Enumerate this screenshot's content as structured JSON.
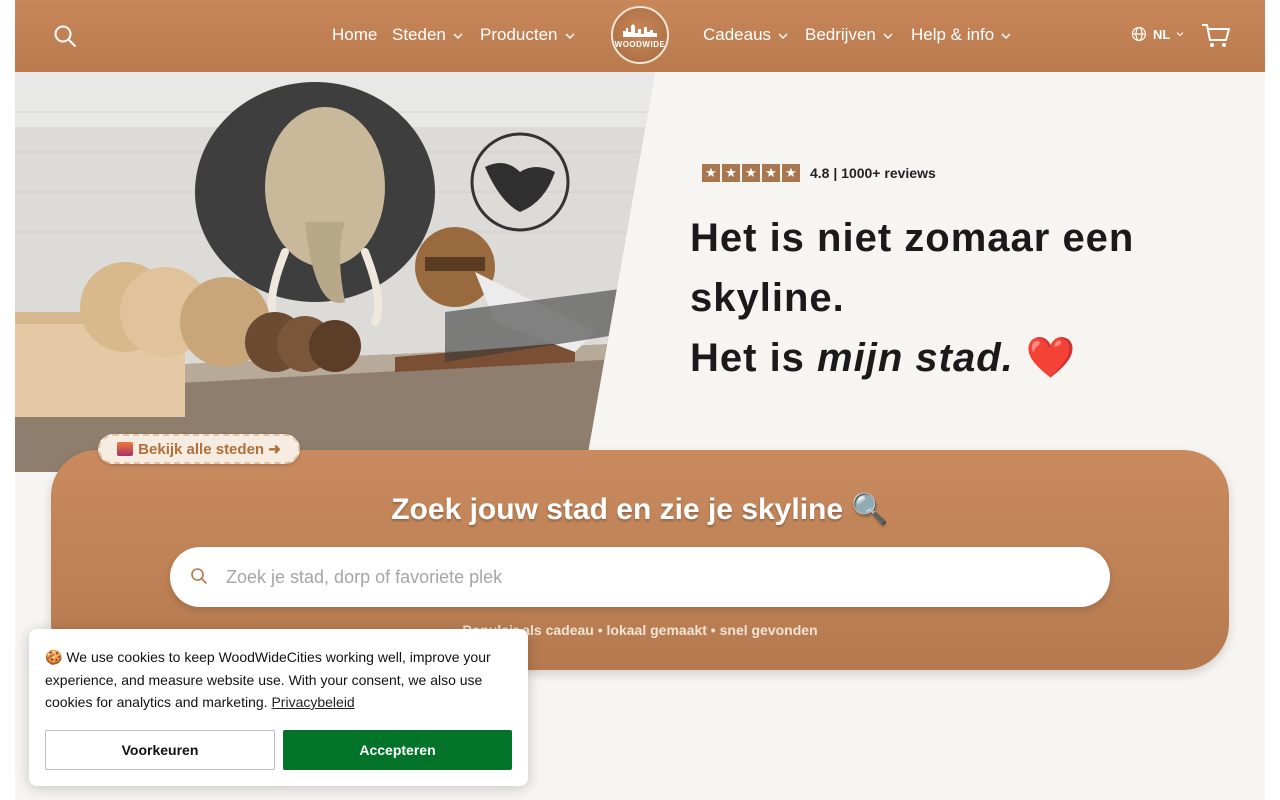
{
  "header": {
    "nav_left": [
      {
        "label": "Home",
        "has_dropdown": false
      },
      {
        "label": "Steden",
        "has_dropdown": true
      },
      {
        "label": "Producten",
        "has_dropdown": true
      }
    ],
    "nav_right": [
      {
        "label": "Cadeaus",
        "has_dropdown": true
      },
      {
        "label": "Bedrijven",
        "has_dropdown": true
      },
      {
        "label": "Help & info",
        "has_dropdown": true
      }
    ],
    "logo_text": "WOODWIDE",
    "language": "NL",
    "icons": [
      "search-icon",
      "globe-icon",
      "cart-icon"
    ],
    "background": "#c08256"
  },
  "hero": {
    "rating": {
      "stars": 5,
      "text": "4.8 | 1000+ reviews"
    },
    "headline_line1": "Het is niet zomaar een skyline.",
    "headline_line2_prefix": "Het is ",
    "headline_line2_em": "mijn stad.",
    "headline_emoji": "❤️",
    "cta_label": "Bekijk alle steden ➜"
  },
  "search": {
    "title": "Zoek jouw stad en zie je skyline 🔍",
    "placeholder": "Zoek je stad, dorp of favoriete plek",
    "value": "",
    "tagline": "Populair als cadeau • lokaal gemaakt • snel gevonden"
  },
  "cookie": {
    "text": "🍪 We use cookies to keep WoodWideCities working well, improve your experience, and measure website use. With your consent, we also use cookies for analytics and marketing.",
    "link_label": "Privacybeleid",
    "preferences_label": "Voorkeuren",
    "accept_label": "Accepteren",
    "accept_color": "#037329"
  },
  "colors": {
    "brand_brown": "#c08256",
    "accent_green": "#037329"
  }
}
